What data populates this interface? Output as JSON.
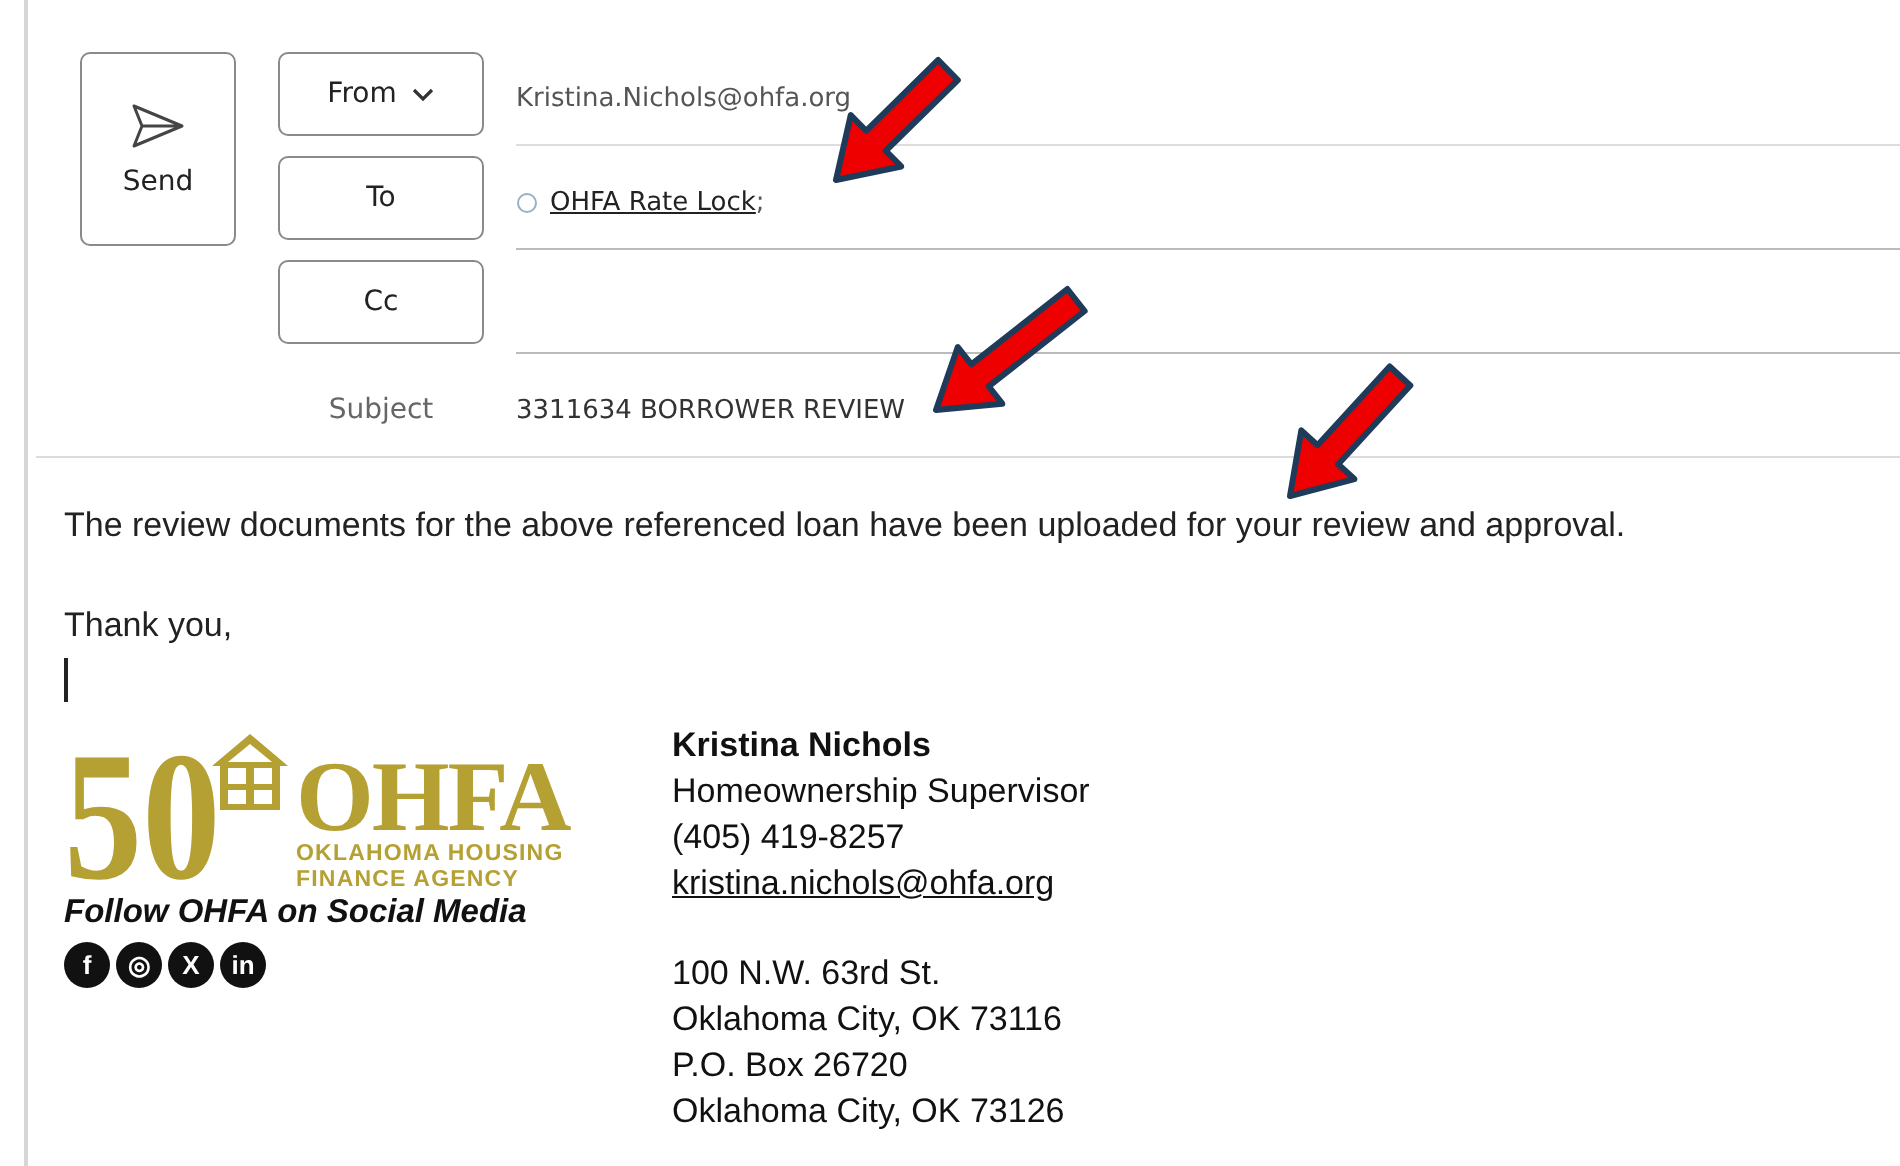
{
  "compose": {
    "send_label": "Send",
    "fields": [
      {
        "kind": "from",
        "button": "From",
        "value": "Kristina.Nichols@ohfa.org"
      },
      {
        "kind": "to",
        "button": "To",
        "recipient": "OHFA Rate Lock",
        "separator": ";"
      },
      {
        "kind": "cc",
        "button": "Cc"
      }
    ],
    "subject_label": "Subject",
    "subject": "3311634 BORROWER REVIEW"
  },
  "body": {
    "paragraphs": [
      "The review documents for the above referenced loan have been uploaded for your review and approval.",
      "Thank you,"
    ]
  },
  "signature": {
    "logo": {
      "number": "50",
      "name": "OHFA",
      "line_1": "OKLAHOMA HOUSING",
      "line_2": "FINANCE AGENCY"
    },
    "follow": "Follow OHFA on Social Media",
    "social": [
      {
        "glyph": "f"
      },
      {
        "glyph": "◎"
      },
      {
        "glyph": "X"
      },
      {
        "glyph": "in"
      }
    ],
    "name": "Kristina Nichols",
    "title": "Homeownership Supervisor",
    "phone": "(405) 419-8257",
    "email": "kristina.nichols@ohfa.org",
    "address": [
      "100 N.W. 63rd St.",
      "Oklahoma City, OK 73116",
      "P.O. Box 26720",
      "Oklahoma City, OK 73126"
    ]
  }
}
